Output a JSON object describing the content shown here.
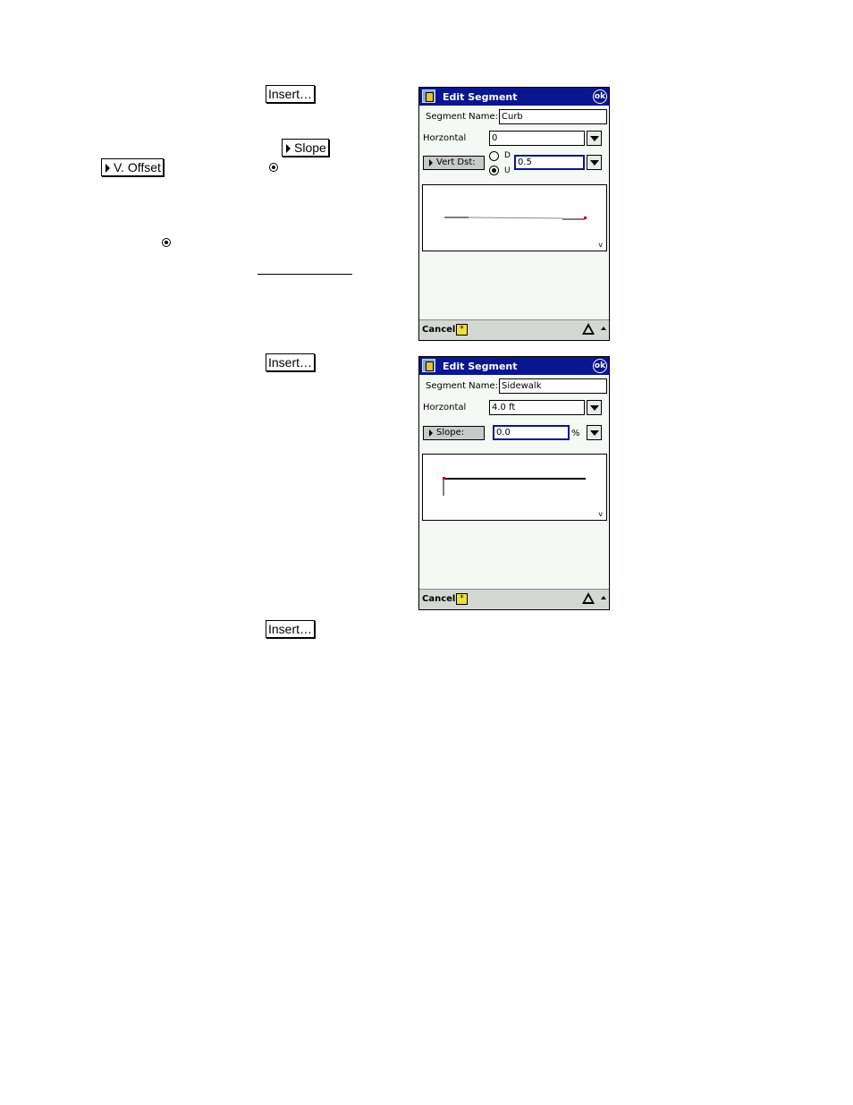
{
  "document": {
    "insert_label": "Insert…",
    "slope_label": "Slope",
    "voffset_label": "V. Offset"
  },
  "screen1": {
    "title": "Edit Segment",
    "ok_label": "ok",
    "segment_name_label": "Segment Name:",
    "segment_name_value": "Curb",
    "horizontal_label": "Horzontal",
    "horizontal_value": "0",
    "vert_btn_label": "Vert Dst:",
    "radio_d_label": "D",
    "radio_u_label": "U",
    "radio_selected": "U",
    "vert_value": "0.5",
    "preview_axis_label": "v",
    "cancel_label": "Cancel"
  },
  "screen2": {
    "title": "Edit Segment",
    "ok_label": "ok",
    "segment_name_label": "Segment Name:",
    "segment_name_value": "Sidewalk",
    "horizontal_label": "Horzontal",
    "horizontal_value": "4.0 ft",
    "slope_btn_label": "Slope:",
    "slope_value": "0.0",
    "slope_unit": "%",
    "preview_axis_label": "v",
    "cancel_label": "Cancel"
  },
  "colors": {
    "titlebar": "#0a1590",
    "screen_bg": "#f4f9f4",
    "marker": "#cc0000"
  }
}
